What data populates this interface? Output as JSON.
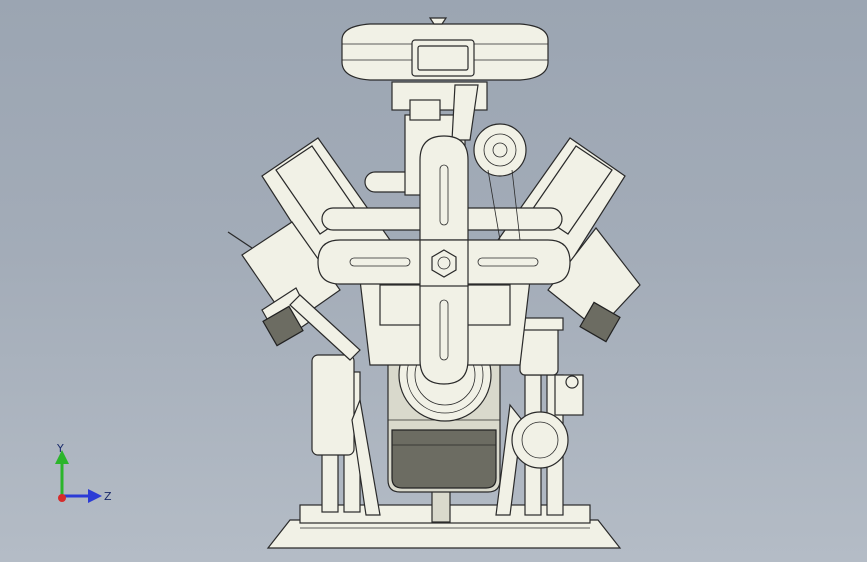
{
  "app": {
    "view": "front",
    "colors": {
      "background_top": "#9ba5b2",
      "background_bottom": "#b4bcc6",
      "part_fill": "#f1f1e6",
      "part_edge": "#2a2a2a",
      "axis_y": "#2bb52b",
      "axis_z": "#2b3bd6",
      "axis_x": "#d62b2b"
    }
  },
  "triad": {
    "y_label": "Y",
    "z_label": "Z"
  },
  "model": {
    "icons": [
      "engine-model"
    ]
  }
}
